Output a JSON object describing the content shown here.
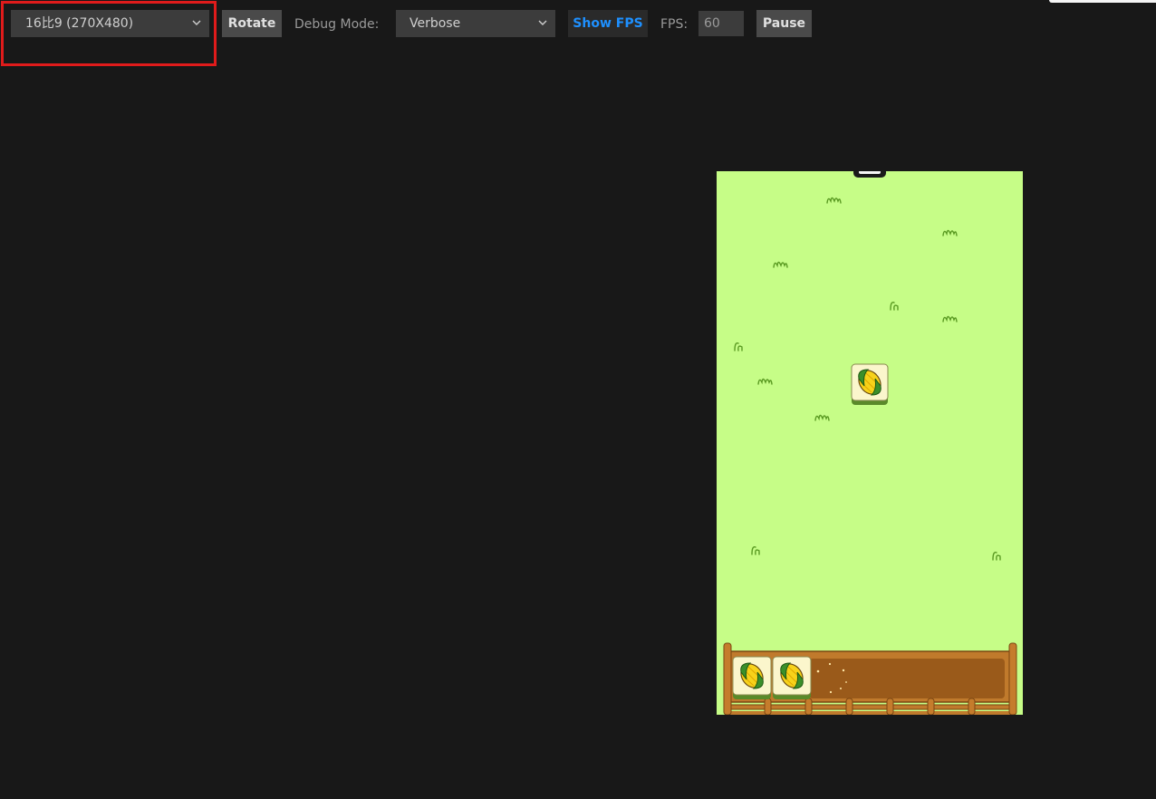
{
  "toolbar": {
    "resolution_select": "16比9 (270X480)",
    "rotate_label": "Rotate",
    "debug_mode_label": "Debug Mode:",
    "debug_mode_select": "Verbose",
    "show_fps_label": "Show FPS",
    "fps_label": "FPS:",
    "fps_value": "60",
    "pause_label": "Pause"
  },
  "colors": {
    "background": "#181818",
    "highlight": "#e01b1b",
    "grass": "#c6fd87",
    "accent_blue": "#1e90ff",
    "fence": "#b8722a",
    "tray": "#9a5a1a"
  },
  "game": {
    "board_tiles": [
      "corn-tile"
    ],
    "tray_tiles": [
      "corn-tile",
      "corn-tile"
    ]
  }
}
